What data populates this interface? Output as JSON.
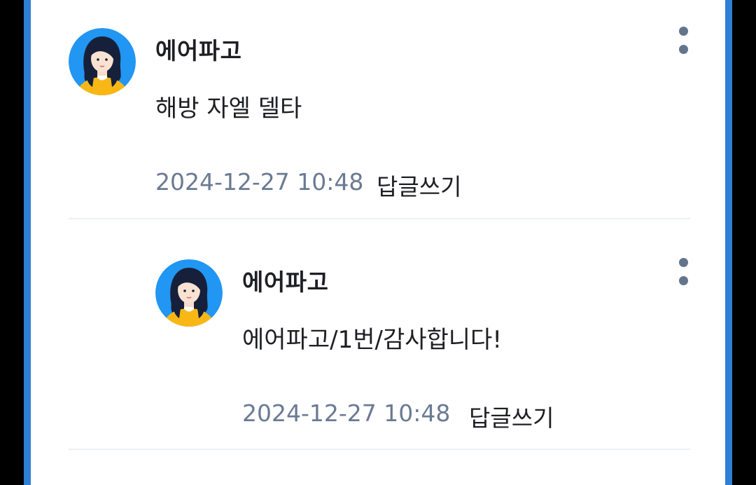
{
  "colors": {
    "frame_blue": "#2f7fd6",
    "panel_bg": "#ffffff",
    "timestamp_gray": "#6b7a93",
    "more_dots": "#64748b",
    "avatar_bg": "#2196f3",
    "avatar_shirt": "#f9b716"
  },
  "comments": [
    {
      "author": "에어파고",
      "text": "해방 자엘 델타",
      "timestamp": "2024-12-27 10:48",
      "reply_label": "답글쓰기",
      "avatar_icon": "woman-avatar-icon",
      "more_icon": "more-vertical-icon"
    },
    {
      "author": "에어파고",
      "text": "에어파고/1번/감사합니다!",
      "timestamp": "2024-12-27 10:48",
      "reply_label": "답글쓰기",
      "avatar_icon": "woman-avatar-icon",
      "more_icon": "more-vertical-icon",
      "is_reply": true
    }
  ]
}
